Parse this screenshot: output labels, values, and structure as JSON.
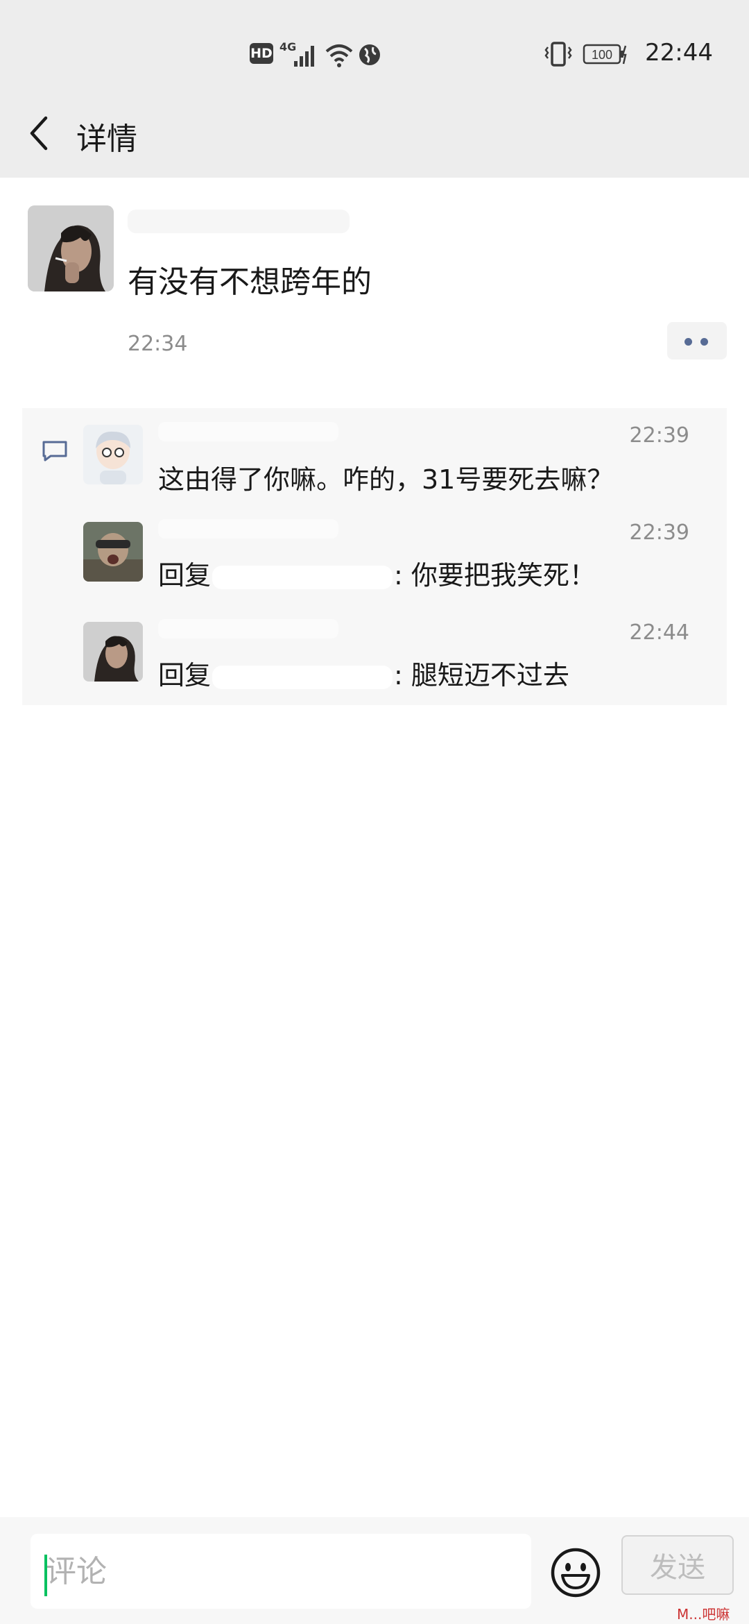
{
  "status_bar": {
    "hd_label": "HD",
    "network_label": "4G",
    "battery_level": "100",
    "time": "22:44"
  },
  "header": {
    "title": "详情"
  },
  "post": {
    "text": "有没有不想跨年的",
    "time": "22:34"
  },
  "comments": [
    {
      "time": "22:39",
      "text": "这由得了你嘛。咋的，31号要死去嘛？"
    },
    {
      "time": "22:39",
      "prefix": "回复",
      "suffix": ": 你要把我笑死！"
    },
    {
      "time": "22:44",
      "prefix": "回复",
      "suffix": ": 腿短迈不过去"
    }
  ],
  "input_bar": {
    "placeholder": "评论",
    "send_label": "发送"
  },
  "watermark": "M...吧嘛",
  "colors": {
    "header_bg": "#ededed",
    "link_blue": "#576b95",
    "caret_green": "#07c160"
  },
  "icons": [
    "back-icon",
    "comment-icon",
    "emoji-icon",
    "more-dots-icon"
  ]
}
